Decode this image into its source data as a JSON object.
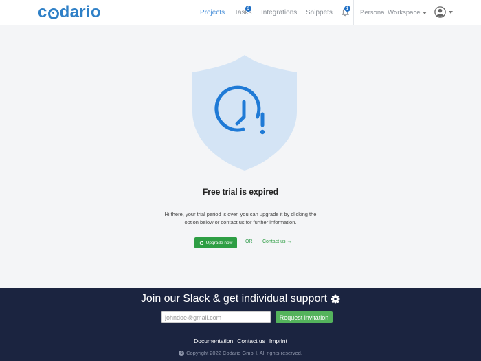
{
  "header": {
    "logo_text": "codario",
    "nav": {
      "projects": "Projects",
      "tasks": "Tasks",
      "tasks_badge": "3",
      "integrations": "Integrations",
      "snippets": "Snippets"
    },
    "notifications_badge": "1",
    "workspace": "Personal Workspace"
  },
  "main": {
    "title": "Free trial is expired",
    "description": "Hi there, your trial period is over. you can upgrade it by clicking the option below or contact us for further information.",
    "upgrade_label": "Upgrade now",
    "or_label": "OR",
    "contact_label": "Contact us →"
  },
  "footer": {
    "slack_heading": "Join our Slack & get individual support",
    "email_placeholder": "johndoe@gmail.com",
    "request_label": "Request invitation",
    "links": {
      "documentation": "Documentation",
      "contact": "Contact us",
      "imprint": "Imprint"
    },
    "copyright": "Copyright 2022 Codario GmbH. All rights reserved."
  },
  "colors": {
    "brand_blue": "#2f80c7",
    "shield_fill": "#d4e4f5",
    "icon_blue": "#1f7ad6",
    "action_green": "#2e9e44",
    "footer_bg": "#1b2440"
  }
}
